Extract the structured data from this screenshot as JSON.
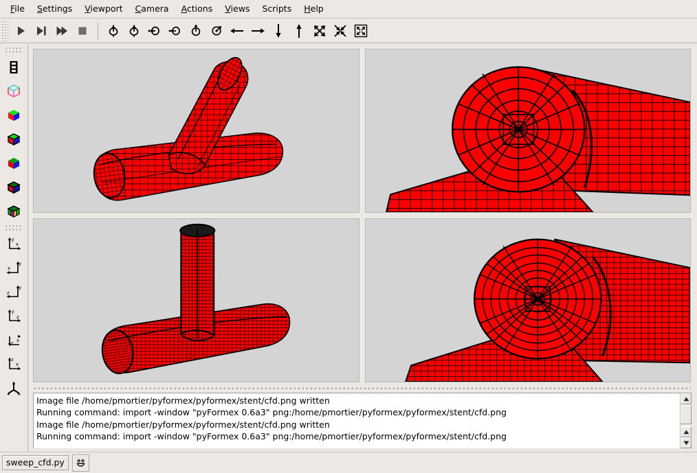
{
  "app": {
    "title": "pyFormex 0.6a3",
    "bg_color": "#ece9e4",
    "viewport_bg": "#d4d4d4",
    "mesh_color": "#ff0000",
    "mesh_edge_color": "#000000"
  },
  "menubar": {
    "items": [
      {
        "label": "File",
        "mnemonic": "F"
      },
      {
        "label": "Settings",
        "mnemonic": "S"
      },
      {
        "label": "Viewport",
        "mnemonic": "V"
      },
      {
        "label": "Camera",
        "mnemonic": "C"
      },
      {
        "label": "Actions",
        "mnemonic": "A"
      },
      {
        "label": "Views",
        "mnemonic": "V"
      },
      {
        "label": "Scripts",
        "mnemonic": ""
      },
      {
        "label": "Help",
        "mnemonic": "H"
      }
    ]
  },
  "toolbar": {
    "groups": [
      {
        "name": "playback",
        "buttons": [
          {
            "icon": "play-icon",
            "tooltip": "Play"
          },
          {
            "icon": "step-icon",
            "tooltip": "Step"
          },
          {
            "icon": "fast-forward-icon",
            "tooltip": "Continue"
          },
          {
            "icon": "stop-icon",
            "tooltip": "Stop"
          }
        ]
      },
      {
        "name": "rotation",
        "buttons": [
          {
            "icon": "rotate-down-icon",
            "tooltip": "Rotate down"
          },
          {
            "icon": "rotate-up-icon",
            "tooltip": "Rotate up"
          },
          {
            "icon": "rotate-right-icon",
            "tooltip": "Rotate right"
          },
          {
            "icon": "rotate-left-icon",
            "tooltip": "Rotate left"
          },
          {
            "icon": "rotate-clockwise-icon",
            "tooltip": "Rotate clockwise"
          },
          {
            "icon": "rotate-counterclockwise-icon",
            "tooltip": "Rotate counterclockwise"
          }
        ]
      },
      {
        "name": "pan",
        "buttons": [
          {
            "icon": "arrow-left-icon",
            "tooltip": "Pan left"
          },
          {
            "icon": "arrow-right-icon",
            "tooltip": "Pan right"
          },
          {
            "icon": "arrow-down-icon",
            "tooltip": "Pan down"
          },
          {
            "icon": "arrow-up-icon",
            "tooltip": "Pan up"
          },
          {
            "icon": "zoom-out-icon",
            "tooltip": "Zoom out"
          },
          {
            "icon": "zoom-in-icon",
            "tooltip": "Zoom in"
          },
          {
            "icon": "zoom-all-icon",
            "tooltip": "Zoom all"
          }
        ]
      }
    ]
  },
  "sidebar": {
    "items": [
      {
        "icon": "ladder-icon",
        "name": "toggle-list"
      },
      {
        "icon": "cube-wireframe-icon",
        "name": "render-wireframe"
      },
      {
        "icon": "cube-flat-icon",
        "name": "render-flat"
      },
      {
        "icon": "cube-flatwire-icon",
        "name": "render-flatwire"
      },
      {
        "icon": "cube-smooth-icon",
        "name": "render-smooth"
      },
      {
        "icon": "cube-smoothwire-icon",
        "name": "render-smoothwire"
      },
      {
        "icon": "cube-colored-icon",
        "name": "render-colored"
      },
      {
        "icon": "axes-xy-icon",
        "name": "view-xy"
      },
      {
        "icon": "axes-yx-icon",
        "name": "view-yx"
      },
      {
        "icon": "axes-zy-icon",
        "name": "view-zy"
      },
      {
        "icon": "axes-yz-icon",
        "name": "view-yz"
      },
      {
        "icon": "axes-zx-icon",
        "name": "view-zx"
      },
      {
        "icon": "axes-xz-icon",
        "name": "view-xz"
      },
      {
        "icon": "axes-iso-icon",
        "name": "view-iso"
      }
    ]
  },
  "viewports": [
    {
      "id": "viewport-1",
      "content": "T-junction pipe mesh, isometric view, coarse quad mesh"
    },
    {
      "id": "viewport-2",
      "content": "Close-up of pipe end cap, coarse quad mesh"
    },
    {
      "id": "viewport-3",
      "content": "T-junction pipe mesh, front view, fine quad mesh"
    },
    {
      "id": "viewport-4",
      "content": "Close-up of pipe end cap, fine quad mesh"
    }
  ],
  "log": {
    "lines": [
      "Image file /home/pmortier/pyformex/pyformex/stent/cfd.png written",
      "Running command: import -window \"pyFormex 0.6a3\" png:/home/pmortier/pyformex/pyformex/stent/cfd.png",
      "Image file /home/pmortier/pyformex/pyformex/stent/cfd.png written",
      "Running command: import -window \"pyFormex 0.6a3\" png:/home/pmortier/pyformex/pyformex/stent/cfd.png"
    ]
  },
  "statusbar": {
    "script_name": "sweep_cfd.py",
    "status_icon": "smiley-icon"
  }
}
